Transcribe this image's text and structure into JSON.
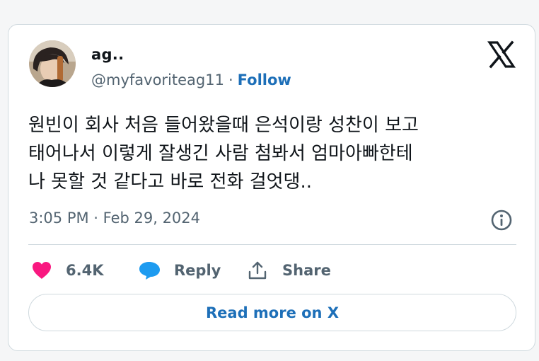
{
  "author": {
    "display_name": "ag..",
    "handle": "@myfavoriteag11",
    "separator": "·",
    "follow_label": "Follow"
  },
  "tweet": {
    "lines": [
      "원빈이 회사 처음 들어왔을때 은석이랑 성찬이 보고",
      "태어나서 이렇게 잘생긴 사람 첨봐서 엄마아빠한테",
      "나 못할 것 같다고 바로 전화 걸엇댕.."
    ],
    "timestamp": "3:05 PM · Feb 29, 2024"
  },
  "actions": {
    "like_count": "6.4K",
    "reply_label": "Reply",
    "share_label": "Share"
  },
  "read_more_label": "Read more on X",
  "icons": {
    "brand": "x-logo-icon",
    "like": "heart-icon",
    "reply": "speech-bubble-icon",
    "share": "share-icon",
    "info": "info-icon"
  },
  "colors": {
    "like": "#f91880",
    "reply": "#1d9bf0",
    "link": "#1d6fb8",
    "muted": "#536471",
    "border": "#cfd9de",
    "text": "#0f1419"
  }
}
